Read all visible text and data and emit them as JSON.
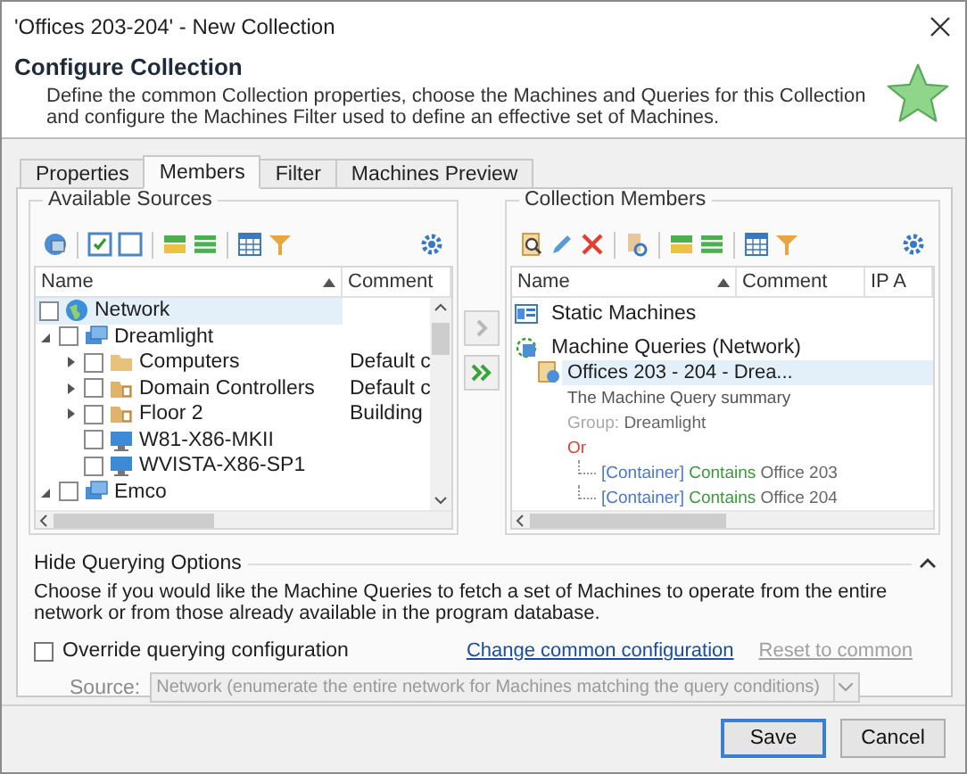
{
  "window": {
    "title": "'Offices 203-204' - New Collection"
  },
  "header": {
    "title": "Configure Collection",
    "description": "Define the common Collection properties, choose the Machines and Queries for this Collection and configure the Machines Filter used to define an effective set of Machines."
  },
  "tabs": [
    {
      "label": "Properties",
      "selected": false
    },
    {
      "label": "Members",
      "selected": true
    },
    {
      "label": "Filter",
      "selected": false
    },
    {
      "label": "Machines Preview",
      "selected": false
    }
  ],
  "available_sources": {
    "title": "Available Sources",
    "columns": [
      "Name",
      "Comment"
    ],
    "nodes": [
      {
        "kind": "network",
        "name": "Network",
        "checked": false,
        "selected": true,
        "children": [
          {
            "kind": "domain",
            "name": "Dreamlight",
            "checked": false,
            "expanded": true,
            "children": [
              {
                "kind": "folder",
                "name": "Computers",
                "comment": "Default c",
                "checked": false,
                "expanded": false
              },
              {
                "kind": "container",
                "name": "Domain Controllers",
                "comment": "Default c",
                "checked": false,
                "expanded": false
              },
              {
                "kind": "container",
                "name": "Floor 2",
                "comment": "Building",
                "checked": false,
                "expanded": false
              },
              {
                "kind": "computer",
                "name": "W81-X86-MKII",
                "checked": false
              },
              {
                "kind": "computer",
                "name": "WVISTA-X86-SP1",
                "checked": false
              }
            ]
          },
          {
            "kind": "domain",
            "name": "Emco",
            "checked": false,
            "expanded": true
          }
        ]
      }
    ]
  },
  "transfer_buttons": [
    {
      "kind": "single",
      "disabled": true
    },
    {
      "kind": "all",
      "disabled": false
    }
  ],
  "collection_members": {
    "title": "Collection Members",
    "columns": [
      "Name",
      "Comment",
      "IP A"
    ],
    "static_machines": "Static Machines",
    "queries_group": "Machine Queries (Network)",
    "query": {
      "name": "Offices 203 - 204 - Drea...",
      "selected": true,
      "summary": "The Machine Query summary",
      "group_label": "Group:",
      "group": "Dreamlight",
      "operator": "Or",
      "conditions": [
        {
          "field": "[Container]",
          "op": "Contains",
          "value": "Office 203"
        },
        {
          "field": "[Container]",
          "op": "Contains",
          "value": "Office 204"
        }
      ]
    }
  },
  "querying_options": {
    "title": "Hide Querying Options",
    "expanded": true,
    "description": "Choose if you would like the Machine Queries to fetch a set of Machines to operate from the entire network or from those already available in the program database.",
    "override": {
      "label": "Override querying configuration",
      "checked": false
    },
    "change_link": "Change common configuration",
    "reset_link": {
      "label": "Reset to common",
      "disabled": true
    },
    "source_label": "Source:",
    "source_value": "Network (enumerate the entire network for Machines matching the query conditions)",
    "source_disabled": true
  },
  "buttons": [
    {
      "label": "Save",
      "default": true
    },
    {
      "label": "Cancel",
      "default": false
    }
  ]
}
